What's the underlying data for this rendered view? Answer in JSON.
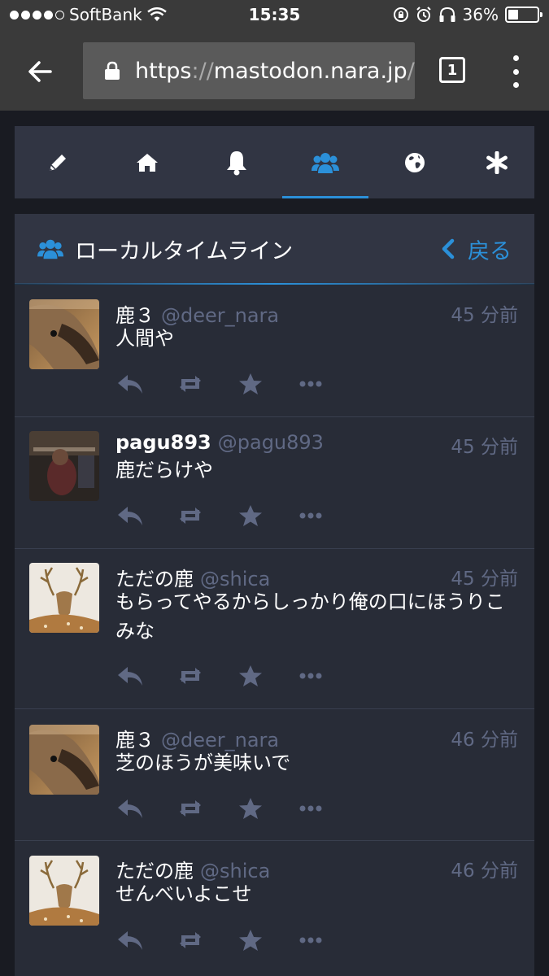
{
  "status_bar": {
    "carrier": "SoftBank",
    "time": "15:35",
    "battery": "36%"
  },
  "browser": {
    "url_scheme": "https",
    "url_sep": "://",
    "url_host": "mastodon.nara.jp",
    "url_tail": "/",
    "tab_count": "1"
  },
  "nav": {
    "items": [
      "compose-icon",
      "home-icon",
      "notifications-icon",
      "local-timeline-icon",
      "federated-timeline-icon",
      "menu-asterisk-icon"
    ],
    "active_index": 3
  },
  "column": {
    "title": "ローカルタイムライン",
    "back_label": "戻る",
    "accent": "#2b90d9"
  },
  "statuses": [
    {
      "display_name": "鹿３",
      "acct": "@deer_nara",
      "time": "45 分前",
      "content": "人間や"
    },
    {
      "display_name": "pagu893",
      "acct": "@pagu893",
      "time": "45 分前",
      "content": "鹿だらけや"
    },
    {
      "display_name": "ただの鹿",
      "acct": "@shica",
      "time": "45 分前",
      "content": "もらってやるからしっかり俺の口にほうりこみな"
    },
    {
      "display_name": "鹿３",
      "acct": "@deer_nara",
      "time": "46 分前",
      "content": "芝のほうが美味いで"
    },
    {
      "display_name": "ただの鹿",
      "acct": "@shica",
      "time": "46 分前",
      "content": "せんべいよこせ"
    }
  ],
  "colors": {
    "background": "#191b22",
    "panel": "#313543",
    "timeline": "#282c37",
    "muted": "#606984"
  }
}
